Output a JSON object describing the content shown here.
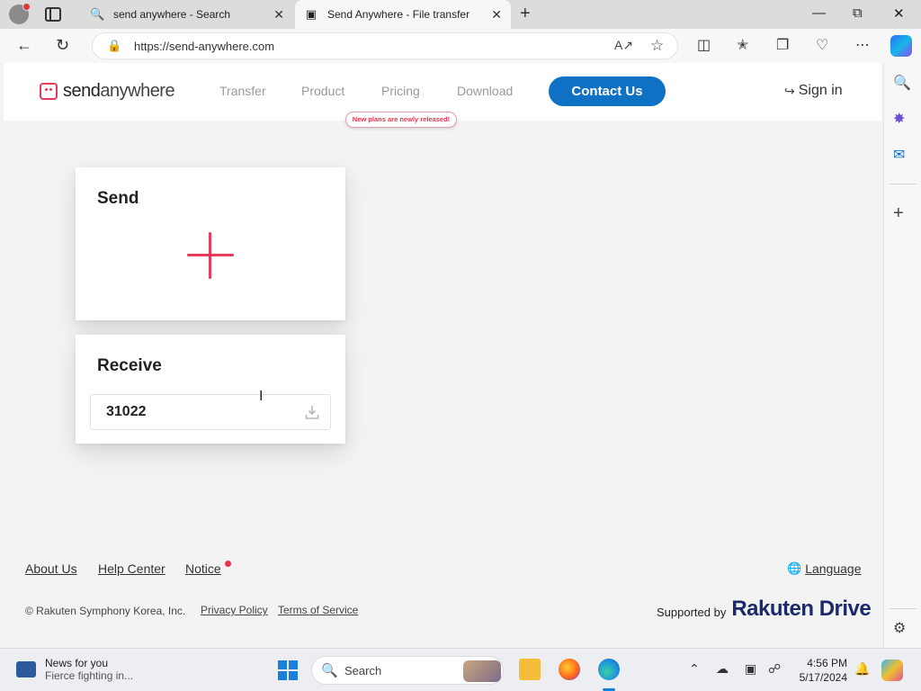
{
  "browser": {
    "tabs": [
      {
        "title": "send anywhere - Search",
        "icon": "search-icon"
      },
      {
        "title": "Send Anywhere - File transfer",
        "icon": "sendanywhere-favicon",
        "active": true
      }
    ],
    "url": "https://send-anywhere.com"
  },
  "site": {
    "logo": {
      "part1": "send",
      "part2": "anywhere"
    },
    "nav": [
      "Transfer",
      "Product",
      "Pricing",
      "Download"
    ],
    "badge": "New plans are newly released!",
    "contact": "Contact Us",
    "signin": "Sign in",
    "brand_color": "#e83a5a",
    "accent_color": "#0f71c4"
  },
  "send": {
    "title": "Send"
  },
  "receive": {
    "title": "Receive",
    "key": "31022"
  },
  "footer": {
    "links": [
      "About Us",
      "Help Center",
      "Notice"
    ],
    "language": "Language",
    "copyright": "© Rakuten Symphony Korea, Inc.",
    "legal": [
      "Privacy Policy",
      "Terms of Service"
    ],
    "supported_by": "Supported by",
    "supporter": "Rakuten Drive"
  },
  "taskbar": {
    "news_title": "News for you",
    "news_sub": "Fierce fighting in...",
    "search": "Search",
    "time": "4:56 PM",
    "date": "5/17/2024"
  }
}
